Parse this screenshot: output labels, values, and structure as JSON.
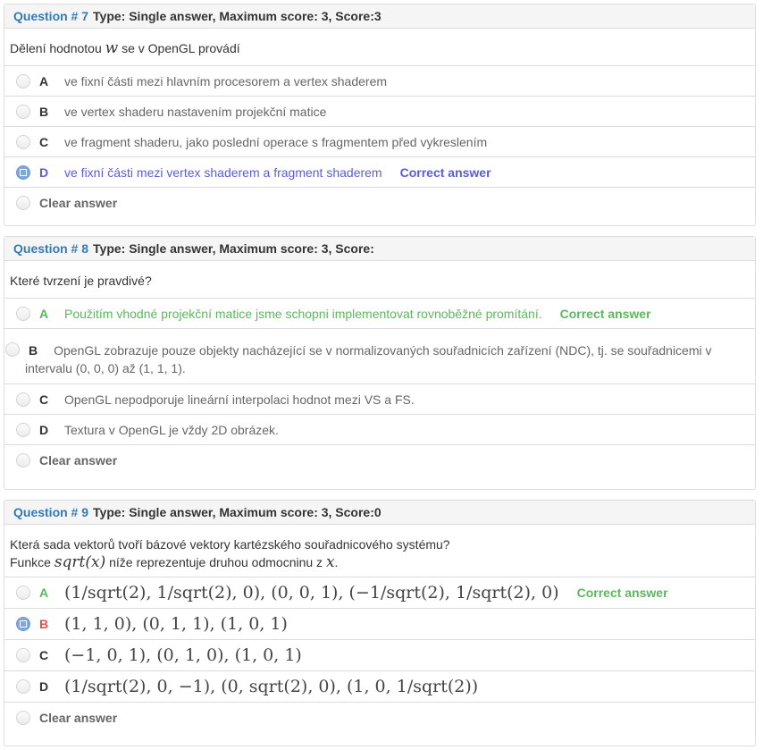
{
  "colors": {
    "link": "#337ab7",
    "correct_green": "#5cb85c",
    "selected_blue": "#5b5bdb",
    "wrong_red": "#d9534f"
  },
  "questions": [
    {
      "number": "Question # 7",
      "meta": "Type: Single answer, Maximum score: 3, Score:3",
      "text_before": "Dělení hodnotou ",
      "text_math": "w",
      "text_after": " se v OpenGL provádí",
      "options": [
        {
          "letter": "A",
          "text": "ve fixní části mezi hlavním procesorem a vertex shaderem"
        },
        {
          "letter": "B",
          "text": "ve vertex shaderu nastavením projekční matice"
        },
        {
          "letter": "C",
          "text": "ve fragment shaderu, jako poslední operace s fragmentem před vykreslením"
        },
        {
          "letter": "D",
          "text": "ve fixní části mezi vertex shaderem a fragment shaderem",
          "tag": "Correct answer"
        }
      ],
      "clear": "Clear answer"
    },
    {
      "number": "Question # 8",
      "meta": "Type: Single answer, Maximum score: 3, Score:",
      "text": "Které tvrzení je pravdivé?",
      "options": [
        {
          "letter": "A",
          "text": "Použitím vhodné projekční matice jsme schopni implementovat rovnoběžné promítání.",
          "tag": "Correct answer"
        },
        {
          "letter": "B",
          "text": "OpenGL zobrazuje pouze objekty nacházející se v normalizovaných souřadnicích zařízení (NDC), tj. se souřadnicemi v",
          "text2": "intervalu (0, 0, 0) až (1, 1, 1)."
        },
        {
          "letter": "C",
          "text": "OpenGL nepodporuje lineární interpolaci hodnot mezi VS a FS."
        },
        {
          "letter": "D",
          "text": "Textura v OpenGL je vždy 2D obrázek."
        }
      ],
      "clear": "Clear answer"
    },
    {
      "number": "Question # 9",
      "meta": "Type: Single answer, Maximum score: 3, Score:0",
      "line1": "Která sada vektorů tvoří bázové vektory kartézského souřadnicového systému?",
      "line2_before": "Funkce ",
      "line2_math": "sqrt(x)",
      "line2_mid": " níže reprezentuje druhou odmocninu z ",
      "line2_math2": "x",
      "line2_after": ".",
      "options": [
        {
          "letter": "A",
          "text": "(1/sqrt(2), 1/sqrt(2), 0), (0, 0, 1), (−1/sqrt(2), 1/sqrt(2), 0)",
          "tag": "Correct answer"
        },
        {
          "letter": "B",
          "text": "(1, 1, 0), (0, 1, 1), (1, 0, 1)"
        },
        {
          "letter": "C",
          "text": "(−1, 0, 1), (0, 1, 0), (1, 0, 1)"
        },
        {
          "letter": "D",
          "text": "(1/sqrt(2), 0, −1), (0, sqrt(2), 0), (1, 0, 1/sqrt(2))"
        }
      ],
      "clear": "Clear answer"
    }
  ]
}
